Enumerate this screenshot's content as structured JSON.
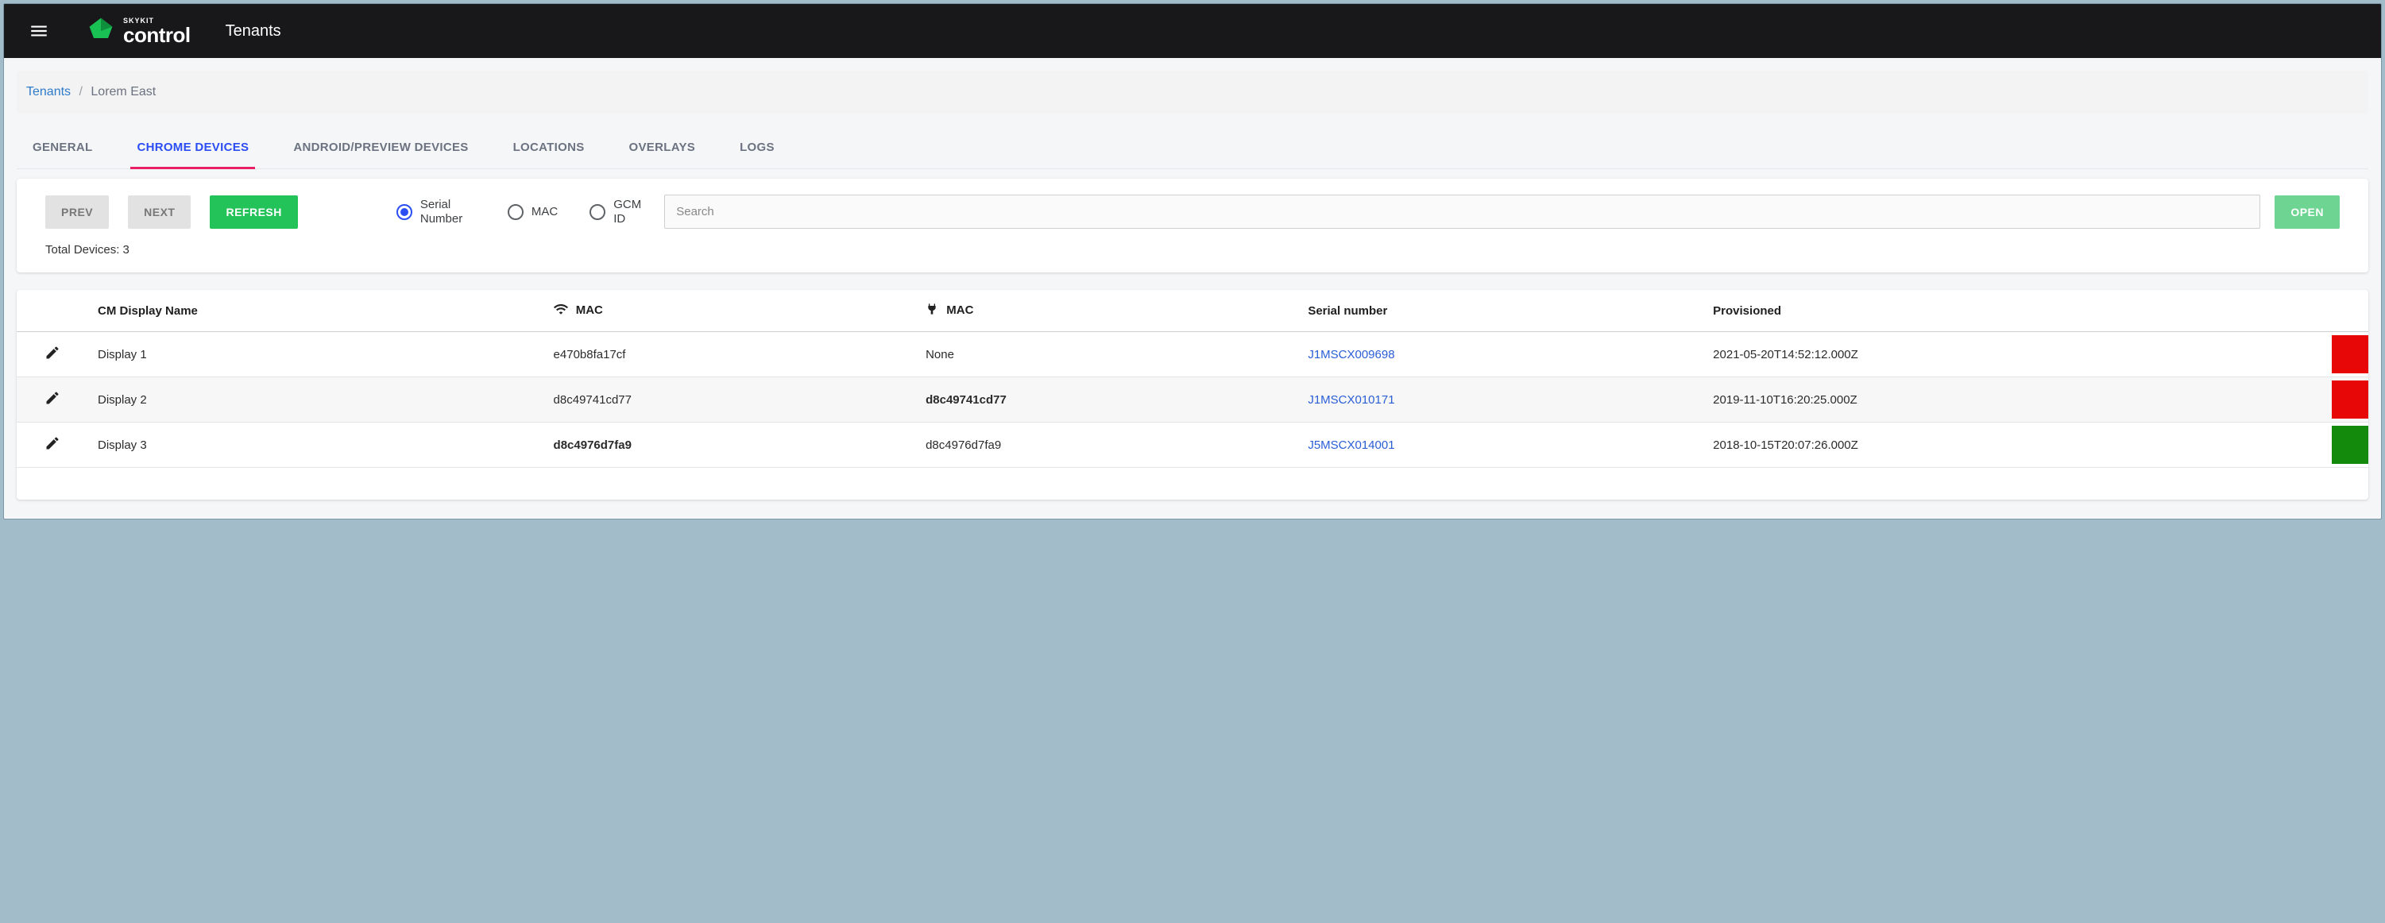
{
  "header": {
    "brand_small": "SKYKIT",
    "brand_big": "control",
    "section": "Tenants"
  },
  "breadcrumb": {
    "root": "Tenants",
    "current": "Lorem East"
  },
  "tabs": [
    {
      "label": "GENERAL"
    },
    {
      "label": "CHROME DEVICES",
      "active": true
    },
    {
      "label": "ANDROID/PREVIEW DEVICES"
    },
    {
      "label": "LOCATIONS"
    },
    {
      "label": "OVERLAYS"
    },
    {
      "label": "LOGS"
    }
  ],
  "controls": {
    "prev": "PREV",
    "next": "NEXT",
    "refresh": "REFRESH",
    "open": "OPEN",
    "search_placeholder": "Search",
    "total_prefix": "Total Devices: ",
    "total_count": "3",
    "radios": {
      "serial": "Serial Number",
      "mac": "MAC",
      "gcm": "GCM ID"
    }
  },
  "table": {
    "headers": {
      "edit": "",
      "name": "CM Display Name",
      "wifi_mac": "MAC",
      "eth_mac": "MAC",
      "serial": "Serial number",
      "provisioned": "Provisioned",
      "status": ""
    },
    "rows": [
      {
        "name": "Display 1",
        "wifi_mac": "e470b8fa17cf",
        "wifi_bold": false,
        "eth_mac": "None",
        "eth_bold": false,
        "serial": "J1MSCX009698",
        "provisioned": "2021-05-20T14:52:12.000Z",
        "status": "red"
      },
      {
        "name": "Display 2",
        "wifi_mac": "d8c49741cd77",
        "wifi_bold": false,
        "eth_mac": "d8c49741cd77",
        "eth_bold": true,
        "serial": "J1MSCX010171",
        "provisioned": "2019-11-10T16:20:25.000Z",
        "status": "red"
      },
      {
        "name": "Display 3",
        "wifi_mac": "d8c4976d7fa9",
        "wifi_bold": true,
        "eth_mac": "d8c4976d7fa9",
        "eth_bold": false,
        "serial": "J5MSCX014001",
        "provisioned": "2018-10-15T20:07:26.000Z",
        "status": "green"
      }
    ]
  }
}
